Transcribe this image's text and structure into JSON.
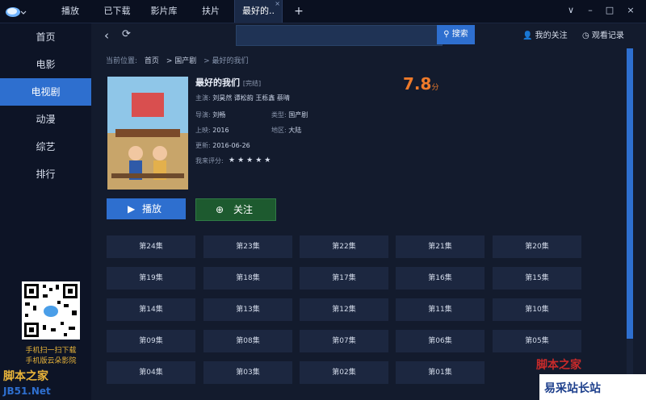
{
  "topbar": {
    "tabs": [
      {
        "label": "播放"
      },
      {
        "label": "已下载"
      },
      {
        "label": "影片库"
      },
      {
        "label": "扶片"
      },
      {
        "label": "最好的.."
      }
    ],
    "add_label": "+",
    "tab_close_label": "×",
    "win_buttons": [
      "∨",
      "–",
      "□",
      "×"
    ]
  },
  "sidebar": {
    "items": [
      {
        "label": "首页"
      },
      {
        "label": "电影"
      },
      {
        "label": "电视剧"
      },
      {
        "label": "动漫"
      },
      {
        "label": "综艺"
      },
      {
        "label": "排行"
      }
    ],
    "active_index": 2,
    "qr_caption1": "手机扫一扫下载",
    "qr_caption2": "手机版云朵影院"
  },
  "toolbar": {
    "search_placeholder": "",
    "search_label": "搜索",
    "my_follow": "我的关注",
    "history": "观看记录"
  },
  "breadcrumb": {
    "prefix": "当前位置:",
    "items": [
      "首页",
      "> 国产剧",
      "> 最好的我们"
    ]
  },
  "detail": {
    "title": "最好的我们",
    "status": "[完结]",
    "score": "7.8",
    "score_unit": "分",
    "cast_label": "主演:",
    "cast": "刘昊然  谭松韵  王栎鑫  蔡晴",
    "director_label": "导演:",
    "director": "刘畅",
    "type_label": "类型:",
    "type": "国产剧",
    "release_label": "上映:",
    "release": "2016",
    "region_label": "地区:",
    "region": "大陆",
    "updated_label": "更新:",
    "updated": "2016-06-26",
    "rate_label": "我来评分:",
    "stars": "★★★★★"
  },
  "actions": {
    "play": "播放",
    "follow": "关注"
  },
  "episodes": [
    "第24集",
    "第23集",
    "第22集",
    "第21集",
    "第20集",
    "第19集",
    "第18集",
    "第17集",
    "第16集",
    "第15集",
    "第14集",
    "第13集",
    "第12集",
    "第11集",
    "第10集",
    "第09集",
    "第08集",
    "第07集",
    "第06集",
    "第05集",
    "第04集",
    "第03集",
    "第02集",
    "第01集"
  ],
  "watermarks": {
    "left_top": "脚本之家",
    "left_bottom": "JB51.Net",
    "right_top": "脚本之家",
    "right_bottom": "易采站长站"
  },
  "colors": {
    "accent": "#2e6fcf",
    "score": "#ee7a2a",
    "follow_btn": "#1d5a2f"
  }
}
